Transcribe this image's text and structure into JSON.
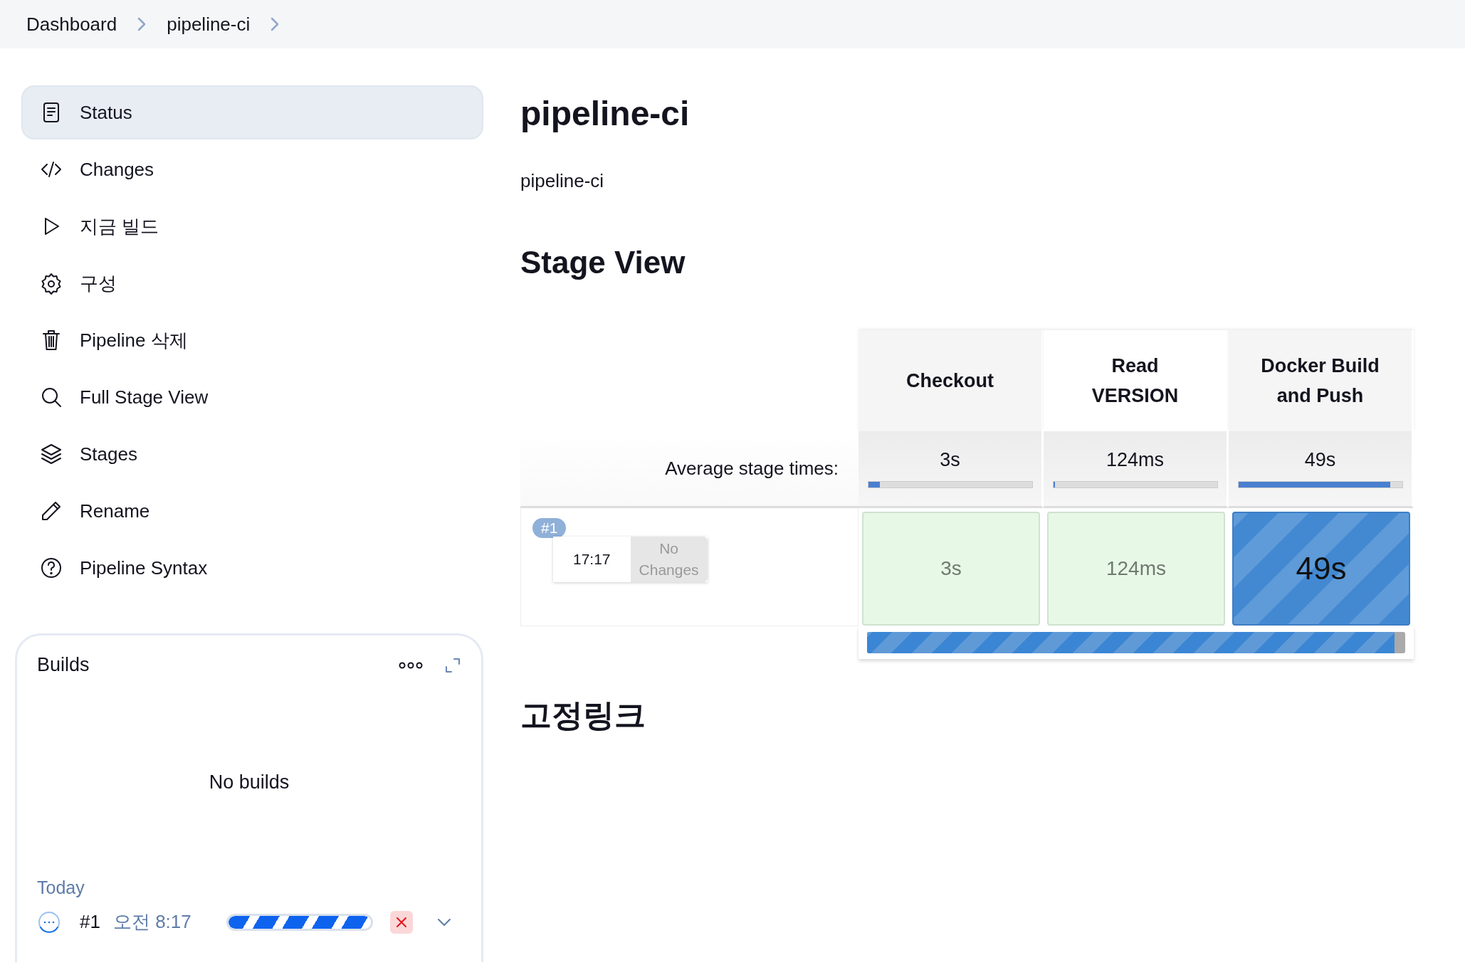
{
  "breadcrumb": [
    {
      "label": "Dashboard"
    },
    {
      "label": "pipeline-ci"
    }
  ],
  "sidebar": {
    "items": [
      {
        "label": "Status",
        "selected": true
      },
      {
        "label": "Changes",
        "selected": false
      },
      {
        "label": "지금 빌드",
        "selected": false
      },
      {
        "label": "구성",
        "selected": false
      },
      {
        "label": "Pipeline 삭제",
        "selected": false
      },
      {
        "label": "Full Stage View",
        "selected": false
      },
      {
        "label": "Stages",
        "selected": false
      },
      {
        "label": "Rename",
        "selected": false
      },
      {
        "label": "Pipeline Syntax",
        "selected": false
      }
    ]
  },
  "builds": {
    "title": "Builds",
    "empty_text": "No builds",
    "group": "Today",
    "rows": [
      {
        "number": "#1",
        "time": "오전 8:17",
        "kind": "in_progress",
        "level": 1
      }
    ]
  },
  "main": {
    "title": "pipeline-ci",
    "description": "pipeline-ci",
    "stage_view_title": "Stage View",
    "permalinks_title": "고정링크"
  },
  "stage_view": {
    "average_label": "Average stage times:",
    "stages": [
      {
        "name": "Checkout",
        "average": "3s",
        "level": 0.07
      },
      {
        "name": "Read VERSION",
        "average": "124ms",
        "level": 0.01
      },
      {
        "name": "Docker Build and Push",
        "average": "49s",
        "level": 0.93
      }
    ],
    "runs": [
      {
        "badge": "#1",
        "time": "17:17",
        "changes": "No Changes",
        "level": 0.98,
        "cells": [
          {
            "duration": "3s",
            "kind": "success"
          },
          {
            "duration": "124ms",
            "kind": "success"
          },
          {
            "duration": "49s",
            "kind": "in_progress"
          }
        ]
      }
    ]
  }
}
